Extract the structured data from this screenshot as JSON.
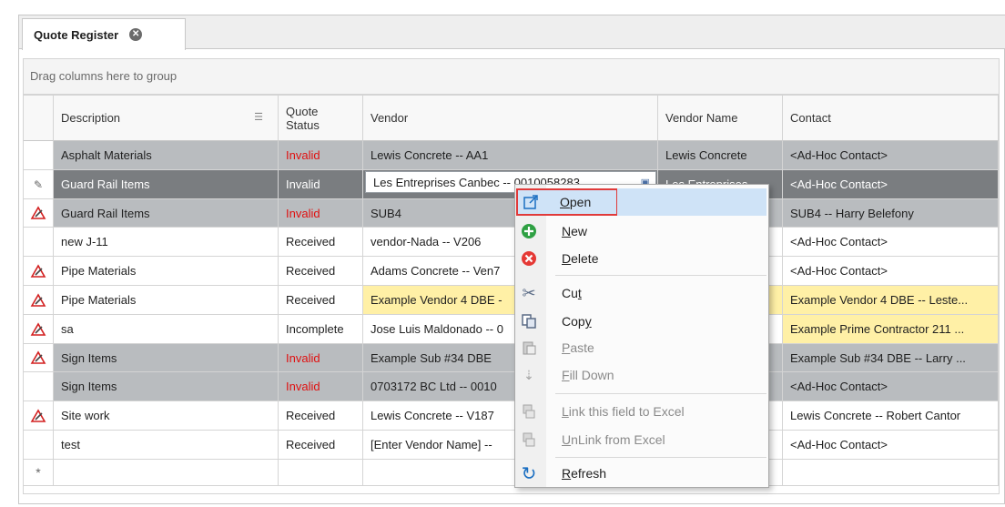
{
  "tab": {
    "title": "Quote Register"
  },
  "group_hint": "Drag columns here to group",
  "columns": [
    "Description",
    "Quote\nStatus",
    "Vendor",
    "Vendor Name",
    "Contact"
  ],
  "rows": [
    {
      "indicator": "",
      "description": "Asphalt Materials",
      "status": "Invalid",
      "vendor": "Lewis Concrete -- AA1",
      "vendor_name": "Lewis Concrete",
      "contact": "<Ad-Hoc Contact>"
    },
    {
      "indicator": "pencil",
      "description": "Guard Rail Items",
      "status": "Invalid",
      "vendor": "Les Entreprises Canbec -- 0010058283",
      "vendor_name": "Les Entreprises",
      "contact": "<Ad-Hoc Contact>"
    },
    {
      "indicator": "error",
      "description": "Guard Rail Items",
      "status": "Invalid",
      "vendor": "SUB4",
      "vendor_name": "",
      "contact": "SUB4 -- Harry Belefony"
    },
    {
      "indicator": "",
      "description": "new J-11",
      "status": "Received",
      "vendor": "vendor-Nada -- V206",
      "vendor_name": "",
      "contact": "<Ad-Hoc Contact>"
    },
    {
      "indicator": "error",
      "description": "Pipe Materials",
      "status": "Received",
      "vendor": "Adams Concrete -- Ven7",
      "vendor_name": "",
      "contact": "<Ad-Hoc Contact>"
    },
    {
      "indicator": "error",
      "description": "Pipe Materials",
      "status": "Received",
      "vendor": "Example Vendor 4 DBE -",
      "vendor_name": "",
      "contact": "Example Vendor 4 DBE -- Leste..."
    },
    {
      "indicator": "error",
      "description": "sa",
      "status": "Incomplete",
      "vendor": "Jose Luis Maldonado -- 0",
      "vendor_name": "",
      "contact": "Example Prime Contractor 211 ..."
    },
    {
      "indicator": "error",
      "description": "Sign Items",
      "status": "Invalid",
      "vendor": "Example Sub #34 DBE",
      "vendor_name": "",
      "contact": "Example Sub #34 DBE -- Larry ..."
    },
    {
      "indicator": "",
      "description": "Sign Items",
      "status": "Invalid",
      "vendor": "0703172 BC Ltd -- 0010",
      "vendor_name": "",
      "contact": "<Ad-Hoc Contact>"
    },
    {
      "indicator": "error",
      "description": "Site work",
      "status": "Received",
      "vendor": "Lewis Concrete -- V187",
      "vendor_name": "",
      "contact": "Lewis Concrete -- Robert Cantor"
    },
    {
      "indicator": "",
      "description": "test",
      "status": "Received",
      "vendor": "[Enter Vendor Name] --",
      "vendor_name": "",
      "contact": "<Ad-Hoc Contact>"
    }
  ],
  "new_row_indicator": "*",
  "context_menu": {
    "items": [
      {
        "label": "Open",
        "icon": "open-icon",
        "enabled": true
      },
      {
        "label": "New",
        "icon": "plus-icon",
        "enabled": true
      },
      {
        "label": "Delete",
        "icon": "delete-icon",
        "enabled": true
      },
      {
        "label": "Cut",
        "icon": "scissors-icon",
        "enabled": true
      },
      {
        "label": "Copy",
        "icon": "copy-icon",
        "enabled": true
      },
      {
        "label": "Paste",
        "icon": "paste-icon",
        "enabled": false
      },
      {
        "label": "Fill Down",
        "icon": "fill-down-icon",
        "enabled": false
      },
      {
        "label": "Link this field to Excel",
        "icon": "excel-link-icon",
        "enabled": false
      },
      {
        "label": "UnLink from Excel",
        "icon": "excel-unlink-icon",
        "enabled": false
      },
      {
        "label": "Refresh",
        "icon": "refresh-icon",
        "enabled": true
      }
    ]
  },
  "colors": {
    "invalid": "#e01010",
    "selected_row": "#7a7d80",
    "error_row": "#b9bcbf",
    "highlight": "#fff0a6",
    "menu_hover": "#cfe3f7",
    "highlight_box": "#e03a3a"
  }
}
